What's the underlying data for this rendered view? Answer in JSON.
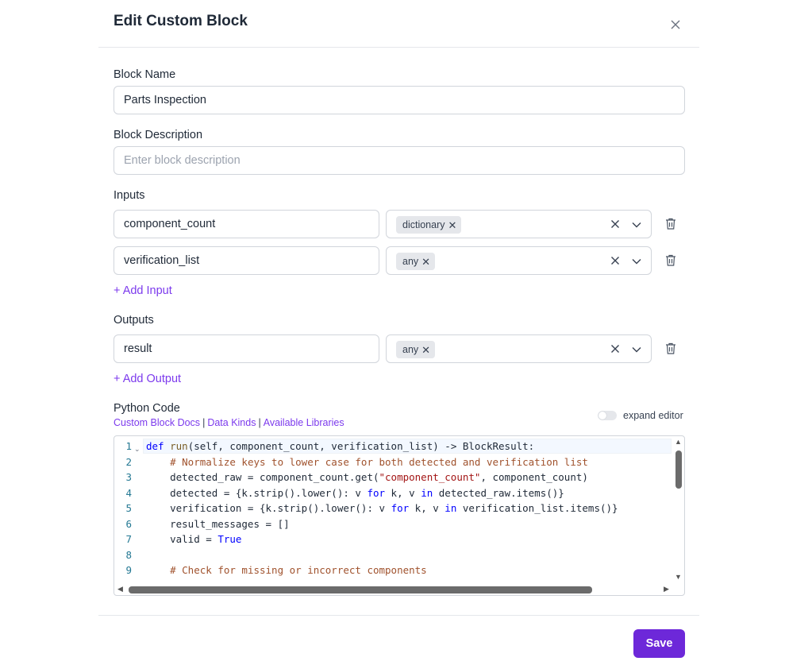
{
  "modal": {
    "title": "Edit Custom Block"
  },
  "block_name": {
    "label": "Block Name",
    "value": "Parts Inspection"
  },
  "block_description": {
    "label": "Block Description",
    "placeholder": "Enter block description",
    "value": ""
  },
  "inputs": {
    "label": "Inputs",
    "rows": [
      {
        "name": "component_count",
        "kind": "dictionary"
      },
      {
        "name": "verification_list",
        "kind": "any"
      }
    ],
    "add_label": "+ Add Input"
  },
  "outputs": {
    "label": "Outputs",
    "rows": [
      {
        "name": "result",
        "kind": "any"
      }
    ],
    "add_label": "+ Add Output"
  },
  "python_code": {
    "label": "Python Code",
    "links": [
      "Custom Block Docs",
      "Data Kinds",
      "Available Libraries"
    ],
    "separator": "|",
    "expand_label": "expand editor",
    "expand_on": false,
    "line_numbers": [
      "1",
      "2",
      "3",
      "4",
      "5",
      "6",
      "7",
      "8",
      "9"
    ],
    "lines": [
      "def run(self, component_count, verification_list) -> BlockResult:",
      "    # Normalize keys to lower case for both detected and verification list",
      "    detected_raw = component_count.get(\"component_count\", component_count)",
      "    detected = {k.strip().lower(): v for k, v in detected_raw.items()}",
      "    verification = {k.strip().lower(): v for k, v in verification_list.items()}",
      "    result_messages = []",
      "    valid = True",
      "",
      "    # Check for missing or incorrect components"
    ]
  },
  "footer": {
    "save_label": "Save"
  },
  "colors": {
    "accent": "#6d28d9",
    "link": "#7c3aed"
  }
}
